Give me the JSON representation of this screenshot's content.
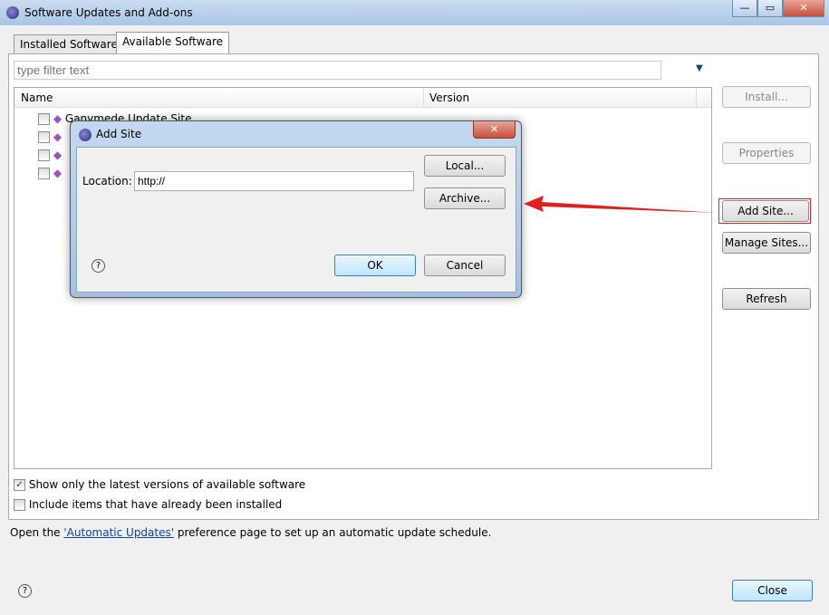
{
  "window": {
    "title": "Software Updates and Add-ons",
    "minimize": "—",
    "maximize": "▭",
    "close": "✕"
  },
  "tabs": [
    {
      "label": "Installed Software"
    },
    {
      "label": "Available Software"
    }
  ],
  "filter": {
    "placeholder": "type filter text"
  },
  "tree": {
    "columns": [
      "Name",
      "Version"
    ],
    "items": [
      {
        "label": "Ganymede Update Site"
      },
      {
        "label": ""
      },
      {
        "label": ""
      },
      {
        "label": ""
      }
    ]
  },
  "side_buttons": {
    "install": "Install...",
    "properties": "Properties",
    "add_site": "Add Site...",
    "manage_sites": "Manage Sites...",
    "refresh": "Refresh"
  },
  "options": [
    {
      "label": "Show only the latest versions of available software",
      "checked": true
    },
    {
      "label": "Include items that have already been installed",
      "checked": false
    }
  ],
  "footer": {
    "prefix": "Open the ",
    "link": "'Automatic Updates'",
    "suffix": " preference page to set up an automatic update schedule.",
    "close": "Close"
  },
  "dialog": {
    "title": "Add Site",
    "location_label": "Location:",
    "location_value": "http://",
    "local": "Local...",
    "archive": "Archive...",
    "ok": "OK",
    "cancel": "Cancel",
    "close": "✕"
  },
  "colors": {
    "highlight": "#e02020",
    "accent": "#3c7fb1"
  }
}
